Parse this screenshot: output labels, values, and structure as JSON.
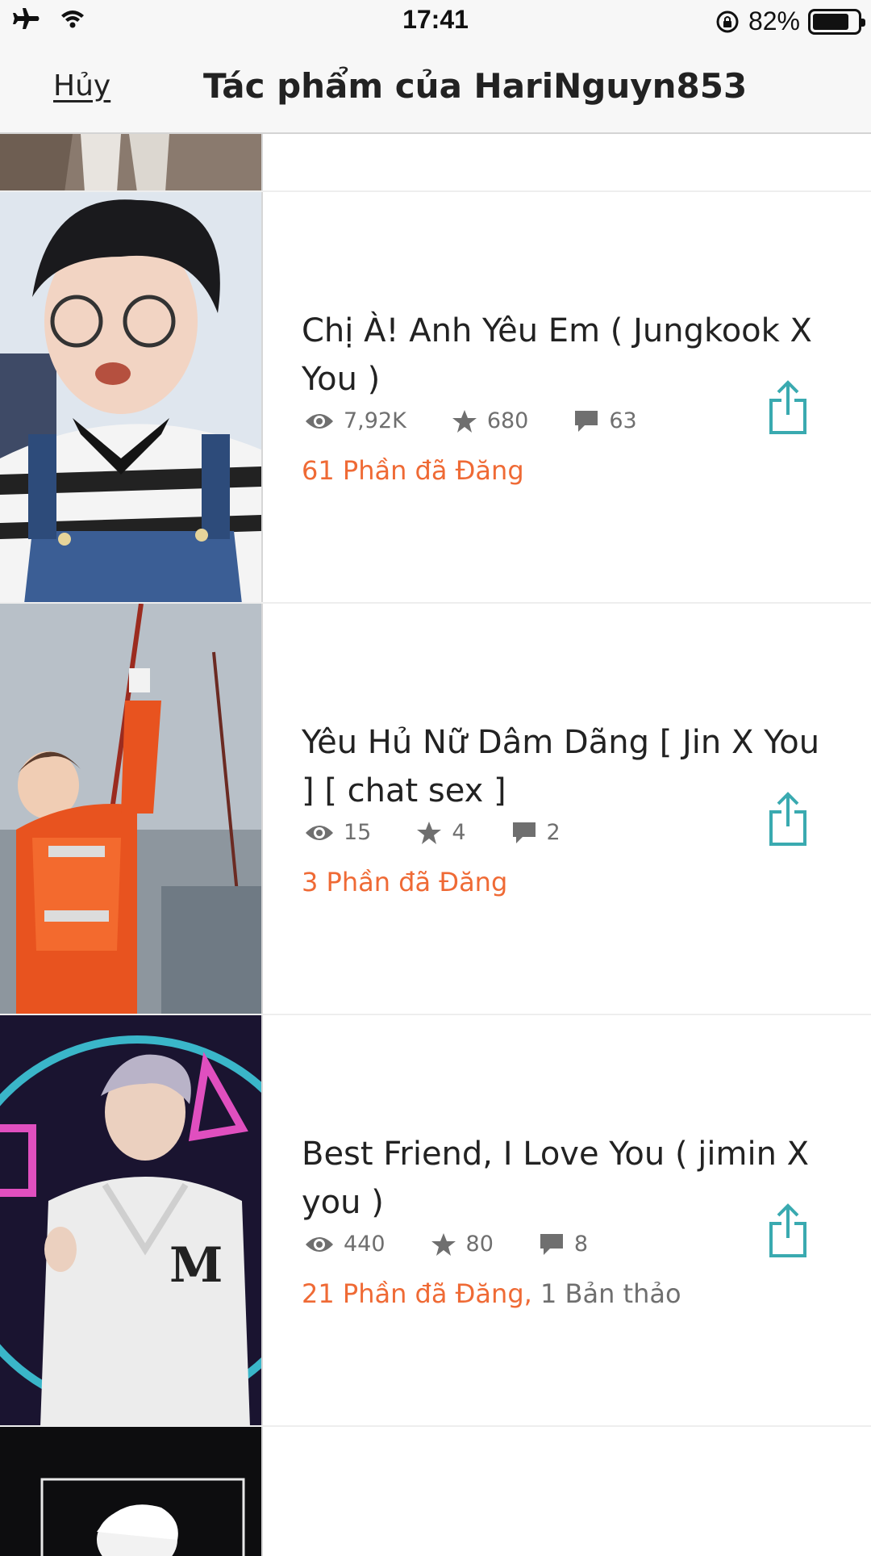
{
  "status_bar": {
    "time": "17:41",
    "battery_percent": "82%",
    "battery_level": 0.82
  },
  "nav": {
    "cancel_label": "Hủy",
    "title": "Tác phẩm của HariNguyn853"
  },
  "colors": {
    "accent_orange": "#ef6a35",
    "share_teal": "#3aaab0",
    "meta_gray": "#6f6f6f"
  },
  "stories": [
    {
      "title": "Chị À! Anh Yêu Em ( Jungkook X You )",
      "reads": "7,92K",
      "votes": "680",
      "comments": "63",
      "published_parts": "61 Phần đã Đăng",
      "drafts": ""
    },
    {
      "title": "Yêu Hủ Nữ Dâm Dãng [ Jin X You ] [ chat sex ]",
      "reads": "15",
      "votes": "4",
      "comments": "2",
      "published_parts": "3 Phần đã Đăng",
      "drafts": ""
    },
    {
      "title": "Best Friend, I Love You ( jimin X you )",
      "reads": "440",
      "votes": "80",
      "comments": "8",
      "published_parts": "21 Phần đã Đăng,",
      "drafts": "1 Bản thảo"
    }
  ],
  "icons": {
    "reads": "eye-icon",
    "votes": "star-icon",
    "comments": "comment-icon",
    "share": "share-icon"
  }
}
